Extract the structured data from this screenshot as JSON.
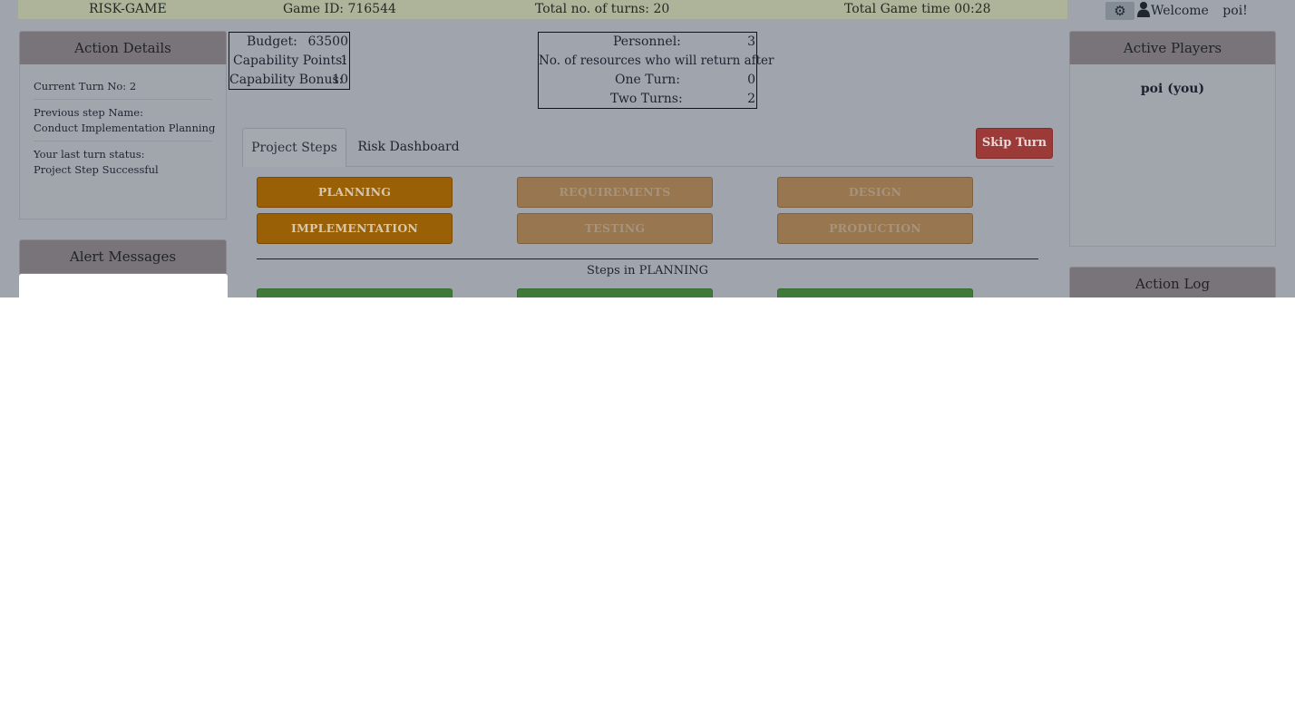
{
  "topbar": {
    "app_name": "RISK-GAME",
    "game_id": "Game ID: 716544",
    "total_turns": "Total no. of turns: 20",
    "game_time": "Total Game time 00:28"
  },
  "user": {
    "welcome": "Welcome",
    "name": "poi!"
  },
  "icons": {
    "settings": "gear-icon",
    "user": "user-icon"
  },
  "action_details": {
    "title": "Action Details",
    "current_turn": "Current Turn No: 2",
    "previous_step_label": "Previous step Name:",
    "previous_step_value": "Conduct Implementation Planning",
    "last_status_label": "Your last turn status:",
    "last_status_value": "Project Step Successful"
  },
  "alert_messages": {
    "title": "Alert Messages"
  },
  "resources": {
    "budget_label": "Budget:",
    "budget_value": "63500",
    "capability_points_label": "Capability Points:",
    "capability_points_value": "1",
    "capability_bonus_label": "Capability Bonus:",
    "capability_bonus_value": "10"
  },
  "personnel": {
    "label": "Personnel:",
    "value": "3",
    "return_header": "No. of resources who will return after",
    "one_turn_label": "One Turn:",
    "one_turn_value": "0",
    "two_turns_label": "Two Turns:",
    "two_turns_value": "2"
  },
  "tabs": {
    "project_steps": "Project Steps",
    "risk_dashboard": "Risk Dashboard"
  },
  "skip_turn": "Skip Turn",
  "phases": {
    "planning": "PLANNING",
    "requirements": "REQUIREMENTS",
    "design": "DESIGN",
    "implementation": "IMPLEMENTATION",
    "testing": "TESTING",
    "production": "PRODUCTION"
  },
  "steps_title": "Steps in PLANNING",
  "active_players": {
    "title": "Active Players",
    "players": [
      "poi (you)"
    ]
  },
  "action_log": {
    "title": "Action Log"
  },
  "colors": {
    "overlay_background": "#9fa4ad",
    "topbar": "#aeb49a",
    "phase_active": "#9a6006",
    "phase_inactive": "#977650",
    "skip_button": "#9c3a38",
    "step_button": "#3f7a3a"
  }
}
